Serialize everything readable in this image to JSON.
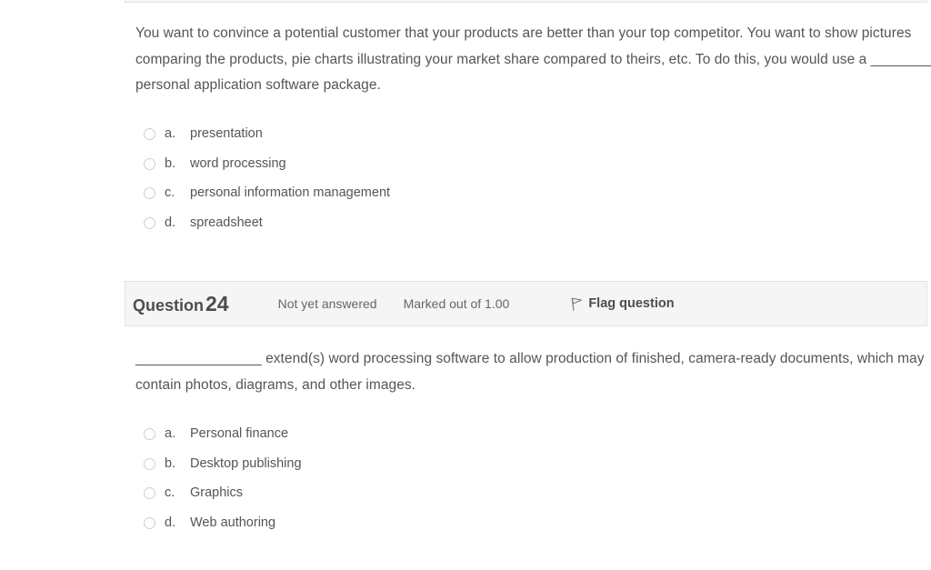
{
  "questions": [
    {
      "id": "q23",
      "text": "You want to convince a potential customer that your products are better than your top competitor. You want to show pictures comparing the products, pie charts illustrating your market share compared to theirs, etc. To do this, you would use a ________ personal application software package.",
      "options": [
        {
          "letter": "a.",
          "label": "presentation",
          "selected": false
        },
        {
          "letter": "b.",
          "label": "word processing",
          "selected": false
        },
        {
          "letter": "c.",
          "label": "personal information management",
          "selected": false
        },
        {
          "letter": "d.",
          "label": "spreadsheet",
          "selected": false
        }
      ]
    },
    {
      "id": "q24",
      "header": {
        "number_word": "Question",
        "number": "24",
        "state": "Not yet answered",
        "grade": "Marked out of 1.00",
        "flag_label": "Flag question",
        "flag_icon": "flag-outline-icon"
      },
      "text": "________________ extend(s) word processing software to allow production of finished, camera-ready documents, which may contain photos, diagrams, and other images.",
      "options": [
        {
          "letter": "a.",
          "label": "Personal finance",
          "selected": false
        },
        {
          "letter": "b.",
          "label": "Desktop publishing",
          "selected": false
        },
        {
          "letter": "c.",
          "label": "Graphics",
          "selected": false
        },
        {
          "letter": "d.",
          "label": "Web authoring",
          "selected": false
        }
      ]
    }
  ],
  "colors": {
    "page_background": "#ffffff",
    "text": "#555555",
    "header_background": "#f5f5f5",
    "header_border": "#e3e3e3",
    "radio_border": "#cfcfcf"
  }
}
